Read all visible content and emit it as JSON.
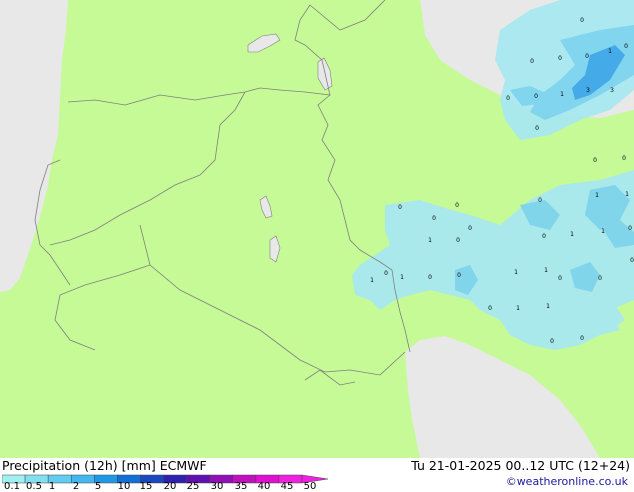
{
  "header": {
    "title": "Precipitation (12h) [mm] ECMWF",
    "valid": "Tu 21-01-2025 00..12 UTC (12+24)",
    "credit": "©weatheronline.co.uk"
  },
  "legend": {
    "labels": [
      "0.1",
      "0.5",
      "1",
      "2",
      "5",
      "10",
      "15",
      "20",
      "25",
      "30",
      "35",
      "40",
      "45",
      "50"
    ],
    "colors": [
      "#a0f0f0",
      "#80e0f0",
      "#60cdf0",
      "#40b8f0",
      "#2098e8",
      "#1070d8",
      "#1848c0",
      "#3020b0",
      "#6010b0",
      "#9010b8",
      "#c010c0",
      "#e010d0",
      "#f020e0"
    ]
  },
  "map": {
    "colors": {
      "land": "#c5fa96",
      "sea": "#e8e8e8",
      "border": "#808080",
      "rain_light": "#a8e8f0",
      "rain_mid": "#7dd4f0",
      "rain_heavy": "#3ca8e8"
    },
    "values": [
      "0",
      "1",
      "0",
      "0",
      "0",
      "0",
      "0",
      "0",
      "3",
      "0",
      "1",
      "3",
      "0",
      "0",
      "0",
      "0",
      "0",
      "1",
      "1",
      "1",
      "0",
      "0",
      "1",
      "1",
      "0",
      "1",
      "0",
      "0",
      "1",
      "1",
      "0",
      "0",
      "1",
      "1",
      "0",
      "0",
      "1",
      "0",
      "0",
      "0",
      "0",
      "0"
    ]
  }
}
